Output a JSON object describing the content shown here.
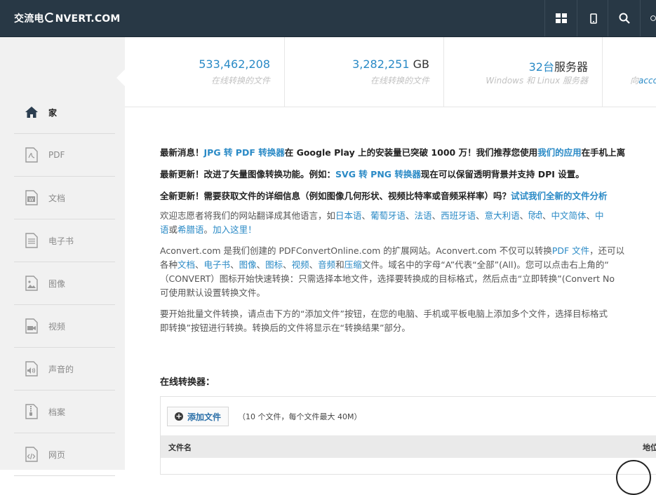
{
  "header": {
    "logo_prefix": "交流电",
    "logo_suffix": "NVERT.COM",
    "buttons": [
      "grid-icon",
      "mobile-icon",
      "search-icon",
      "help-icon"
    ]
  },
  "stats": [
    {
      "number": "533,462,208",
      "unit": "",
      "label": "在线转换的文件"
    },
    {
      "number": "3,282,251",
      "unit": " GB",
      "label": "在线转换的文件"
    },
    {
      "number": "32台",
      "unit": "服务器",
      "label_a": "Windows 和 Linux 服务器"
    },
    {
      "label_prefix": "向",
      "label_link": "acco"
    }
  ],
  "sidebar": {
    "items": [
      {
        "label": "家",
        "icon": "home-icon"
      },
      {
        "label": "PDF",
        "icon": "pdf-file-icon"
      },
      {
        "label": "文档",
        "icon": "word-file-icon"
      },
      {
        "label": "电子书",
        "icon": "ebook-icon"
      },
      {
        "label": "图像",
        "icon": "image-file-icon"
      },
      {
        "label": "视频",
        "icon": "video-file-icon"
      },
      {
        "label": "声音的",
        "icon": "audio-file-icon"
      },
      {
        "label": "档案",
        "icon": "archive-file-icon"
      },
      {
        "label": "网页",
        "icon": "code-file-icon"
      }
    ]
  },
  "news": {
    "n1_pre": "最新消息！",
    "n1_link": "JPG 转 PDF 转换器",
    "n1_mid": "在 Google Play 上的安装量已突破 1000 万！我们推荐您使用",
    "n1_link2": "我们的应用",
    "n1_post": "在手机上离",
    "n2_pre": "最新更新！改进了矢量图像转换功能。例如：",
    "n2_link": "SVG 转 PNG 转换器",
    "n2_post": "现在可以保留透明背景并支持 DPI 设置。",
    "n3_pre": "全新更新！需要获取文件的详细信息（例如图像几何形状、视频比特率或音频采样率）吗？",
    "n3_link": "试试我们全新的文件分析"
  },
  "translate": {
    "pre": "欢迎志愿者将我们的网站翻译成其他语言，如",
    "langs": [
      "日本语",
      "葡萄牙语",
      "法语",
      "西班牙语",
      "意大利语",
      "हिंदी",
      "中文简体",
      "中"
    ],
    "sep": "、",
    "l2_link1": "语",
    "l2_or": "或",
    "l2_link2": "希腊语",
    "l2_dot": "。",
    "join": "加入这里！"
  },
  "about": {
    "l1_pre": "Aconvert.com 是我们创建的 PDFConvertOnline.com 的扩展网站。Aconvert.com 不仅可以转换",
    "l1_link": "PDF 文件",
    "l1_post": "，还可以",
    "l2_pre": "各种",
    "l2_links": [
      "文档",
      "电子书",
      "图像",
      "图标",
      "视频",
      "音频"
    ],
    "l2_and": "和",
    "l2_link_last": "压缩",
    "l2_post": "文件。域名中的字母“A”代表“全部”(All)。您可以点击右上角的“",
    "l3": "（CONVERT）图标开始快速转换：只需选择本地文件，选择要转换成的目标格式，然后点击“立即转换”(Convert No",
    "l4": "可使用默认设置转换文件。"
  },
  "howto": {
    "l1": "要开始批量文件转换，请点击下方的“添加文件”按钮，在您的电脑、手机或平板电脑上添加多个文件，选择目标格式",
    "l2": "即转换”按钮进行转换。转换后的文件将显示在“转换结果”部分。"
  },
  "converter": {
    "title": "在线转换器：",
    "add_button": "添加文件",
    "limit": "（10 个文件，每个文件最大 40M）",
    "col_filename": "文件名",
    "col_location": "地位"
  },
  "colors": {
    "topbar": "#283845",
    "link": "#2a8ac6",
    "sidebar_bg": "#f1f1f1"
  }
}
